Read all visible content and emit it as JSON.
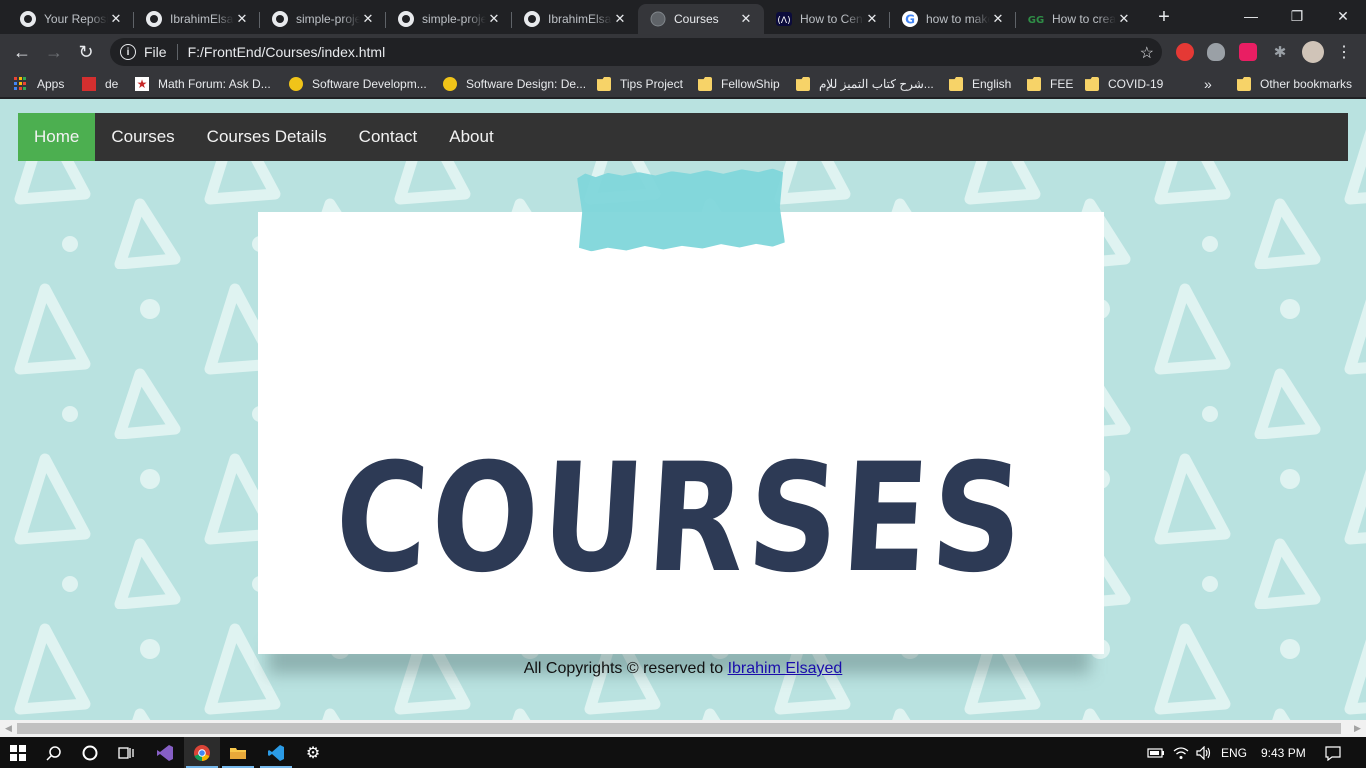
{
  "browser": {
    "tabs": [
      {
        "title": "Your Repositories",
        "icon": "github-icon",
        "active": false
      },
      {
        "title": "IbrahimElsayed",
        "icon": "github-icon",
        "active": false
      },
      {
        "title": "simple-project",
        "icon": "github-icon",
        "active": false
      },
      {
        "title": "simple-project",
        "icon": "github-icon",
        "active": false
      },
      {
        "title": "IbrahimElsayed",
        "icon": "github-icon",
        "active": false
      },
      {
        "title": "Courses",
        "icon": "globe-icon",
        "active": true
      },
      {
        "title": "How to Center",
        "icon": "codepen-icon",
        "active": false
      },
      {
        "title": "how to make",
        "icon": "google-icon",
        "active": false
      },
      {
        "title": "How to create",
        "icon": "geeksforgeeks-icon",
        "active": false
      }
    ],
    "address": {
      "scheme_label": "File",
      "url": "F:/FrontEnd/Courses/index.html"
    },
    "bookmarks": {
      "apps": "Apps",
      "items": [
        {
          "label": "de",
          "icon": "red-bookmark-icon"
        },
        {
          "label": "Math Forum: Ask D...",
          "icon": "star-bookmark-icon"
        },
        {
          "label": "Software Developm...",
          "icon": "penguin-icon"
        },
        {
          "label": "Software Design: De...",
          "icon": "penguin-icon"
        },
        {
          "label": "Tips Project",
          "icon": "folder-icon"
        },
        {
          "label": "FellowShip",
          "icon": "folder-icon"
        },
        {
          "label": "شرح كتاب التميز للإم...",
          "icon": "folder-icon"
        },
        {
          "label": "English",
          "icon": "folder-icon"
        },
        {
          "label": "FEE",
          "icon": "folder-icon"
        },
        {
          "label": "COVID-19",
          "icon": "folder-icon"
        }
      ],
      "overflow": "»",
      "other": "Other bookmarks"
    }
  },
  "page": {
    "nav": [
      "Home",
      "Courses",
      "Courses Details",
      "Contact",
      "About"
    ],
    "active_nav": "Home",
    "hero_title": "COURSES",
    "footer_text": "All Copyrights © reserved to ",
    "footer_link": "Ibrahim Elsayed",
    "colors": {
      "background": "#b9e2e0",
      "navbar": "#333333",
      "nav_active": "#4caf50",
      "title": "#2d3a55",
      "tape": "#7fd6da"
    }
  },
  "taskbar": {
    "language": "ENG",
    "time": "9:43 PM"
  }
}
